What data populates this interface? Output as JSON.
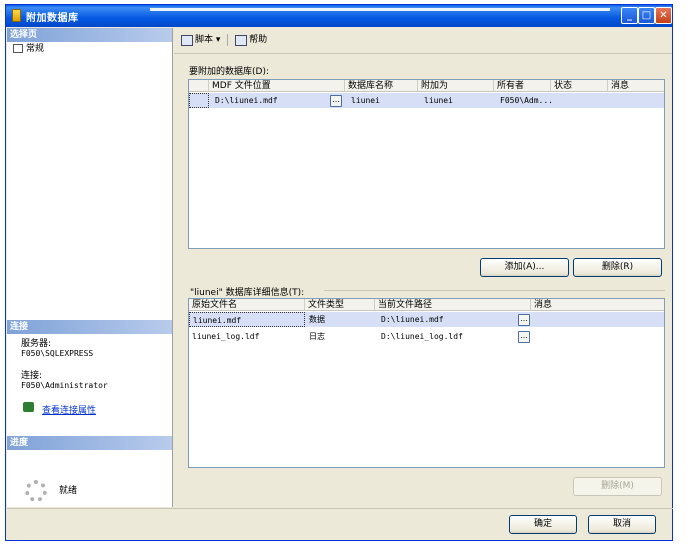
{
  "window": {
    "title": "附加数据库"
  },
  "left": {
    "select_page_header": "选择页",
    "pages": [
      {
        "label": "常规"
      }
    ],
    "connection_header": "连接",
    "server_label": "服务器:",
    "server_value": "F050\\SQLEXPRESS",
    "connection_label": "连接:",
    "connection_value": "F050\\Administrator",
    "view_props_link": "查看连接属性",
    "progress_header": "进度",
    "progress_status": "就绪"
  },
  "toolbar": {
    "script_label": "脚本",
    "help_label": "帮助"
  },
  "attach": {
    "label": "要附加的数据库(D):",
    "columns": [
      "MDF 文件位置",
      "数据库名称",
      "附加为",
      "所有者",
      "状态",
      "消息"
    ],
    "rows": [
      {
        "mdf": "D:\\liunei.mdf",
        "db_name": "liunei",
        "attach_as": "liunei",
        "owner": "F050\\Adm...",
        "status": "",
        "message": ""
      }
    ],
    "add_button": "添加(A)...",
    "remove_button": "删除(R)"
  },
  "details": {
    "label": "\"liunei\" 数据库详细信息(T):",
    "columns": [
      "原始文件名",
      "文件类型",
      "当前文件路径",
      "消息"
    ],
    "rows": [
      {
        "name": "liunei.mdf",
        "type": "数据",
        "path": "D:\\liunei.mdf",
        "message": ""
      },
      {
        "name": "liunei_log.ldf",
        "type": "日志",
        "path": "D:\\liunei_log.ldf",
        "message": ""
      }
    ],
    "remove_button": "删除(M)"
  },
  "footer": {
    "ok_button": "确定",
    "cancel_button": "取消"
  }
}
